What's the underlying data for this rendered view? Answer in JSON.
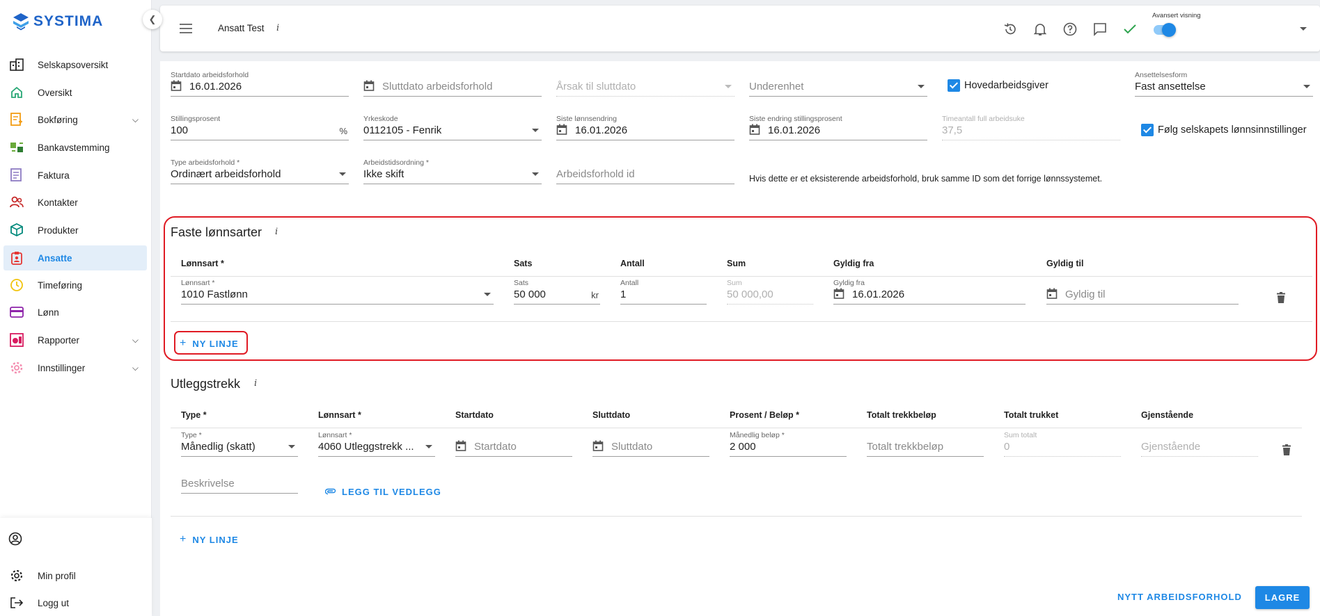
{
  "sidebar": {
    "brand": "SYSTIMA",
    "items": [
      {
        "label": "Selskapsoversikt",
        "icon": "building-icon"
      },
      {
        "label": "Oversikt",
        "icon": "home-icon"
      },
      {
        "label": "Bokføring",
        "icon": "ledger-icon",
        "expandable": true
      },
      {
        "label": "Bankavstemming",
        "icon": "bank-icon"
      },
      {
        "label": "Faktura",
        "icon": "invoice-icon"
      },
      {
        "label": "Kontakter",
        "icon": "contacts-icon"
      },
      {
        "label": "Produkter",
        "icon": "box-icon"
      },
      {
        "label": "Ansatte",
        "icon": "employee-badge-icon",
        "active": true
      },
      {
        "label": "Timeføring",
        "icon": "clock-icon"
      },
      {
        "label": "Lønn",
        "icon": "payment-card-icon"
      },
      {
        "label": "Rapporter",
        "icon": "report-icon",
        "expandable": true
      },
      {
        "label": "Innstillinger",
        "icon": "gear-icon",
        "expandable": true
      }
    ],
    "bottom": {
      "account_icon": "account-circle-icon",
      "profile_label": "Min profil",
      "logout_label": "Logg ut"
    }
  },
  "topbar": {
    "title": "Ansatt Test",
    "info": "i",
    "advanced_view_label": "Avansert visning",
    "advanced_view_on": true
  },
  "employment": {
    "start_date": {
      "label": "Startdato arbeidsforhold",
      "value": "16.01.2026"
    },
    "end_date": {
      "placeholder": "Sluttdato arbeidsforhold"
    },
    "end_reason": {
      "placeholder": "Årsak til sluttdato"
    },
    "subunit": {
      "placeholder": "Underenhet"
    },
    "main_employer": {
      "label": "Hovedarbeidsgiver",
      "checked": true
    },
    "employment_form": {
      "label": "Ansettelsesform",
      "value": "Fast ansettelse"
    },
    "position_percent": {
      "label": "Stillingsprosent",
      "value": "100",
      "suffix": "%"
    },
    "occupation_code": {
      "label": "Yrkeskode",
      "value": "0112105 - Fenrik"
    },
    "last_salary_change": {
      "label": "Siste lønnsendring",
      "value": "16.01.2026"
    },
    "last_percent_change": {
      "label": "Siste endring stillingsprosent",
      "value": "16.01.2026"
    },
    "full_week_hours": {
      "label": "Timeantall full arbeidsuke",
      "value": "37,5"
    },
    "follow_company_settings": {
      "label": "Følg selskapets lønnsinnstillinger",
      "checked": true
    },
    "employment_type": {
      "label": "Type arbeidsforhold *",
      "value": "Ordinært arbeidsforhold"
    },
    "working_time": {
      "label": "Arbeidstidsordning *",
      "value": "Ikke skift"
    },
    "employment_id": {
      "placeholder": "Arbeidsforhold id"
    },
    "id_hint": "Hvis dette er et eksisterende arbeidsforhold, bruk samme ID som det forrige lønnssystemet."
  },
  "fixed_pay": {
    "title": "Faste lønnsarter",
    "info": "i",
    "headers": [
      "Lønnsart *",
      "Sats",
      "Antall",
      "Sum",
      "Gyldig fra",
      "Gyldig til"
    ],
    "row": {
      "pay_type": {
        "label": "Lønnsart *",
        "value": "1010 Fastlønn"
      },
      "rate": {
        "label": "Sats",
        "value": "50 000",
        "suffix": "kr"
      },
      "quantity": {
        "label": "Antall",
        "value": "1"
      },
      "sum": {
        "label": "Sum",
        "value": "50 000,00"
      },
      "valid_from": {
        "label": "Gyldig fra",
        "value": "16.01.2026"
      },
      "valid_to": {
        "placeholder": "Gyldig til"
      }
    },
    "add_line": "NY LINJE"
  },
  "expense_deduction": {
    "title": "Utleggstrekk",
    "info": "i",
    "headers": [
      "Type *",
      "Lønnsart *",
      "Startdato",
      "Sluttdato",
      "Prosent / Beløp *",
      "Totalt trekkbeløp",
      "Totalt trukket",
      "Gjenstående"
    ],
    "row": {
      "type": {
        "label": "Type *",
        "value": "Månedlig (skatt)"
      },
      "pay_type": {
        "label": "Lønnsart *",
        "value": "4060 Utleggstrekk ..."
      },
      "start_date": {
        "placeholder": "Startdato"
      },
      "end_date": {
        "placeholder": "Sluttdato"
      },
      "monthly_amount": {
        "label": "Månedlig beløp *",
        "value": "2 000"
      },
      "total_deduction": {
        "placeholder": "Totalt trekkbeløp"
      },
      "total_sum": {
        "label": "Sum totalt",
        "value": "0"
      },
      "remaining": {
        "placeholder": "Gjenstående"
      }
    },
    "description": {
      "placeholder": "Beskrivelse"
    },
    "attach": "LEGG TIL VEDLEGG",
    "add_line": "NY LINJE"
  },
  "footer": {
    "new_employment": "NYTT ARBEIDSFORHOLD",
    "save": "LAGRE"
  },
  "colors": {
    "accent": "#1e88e5",
    "highlight": "#e01b24",
    "brand": "#1f64c8"
  }
}
